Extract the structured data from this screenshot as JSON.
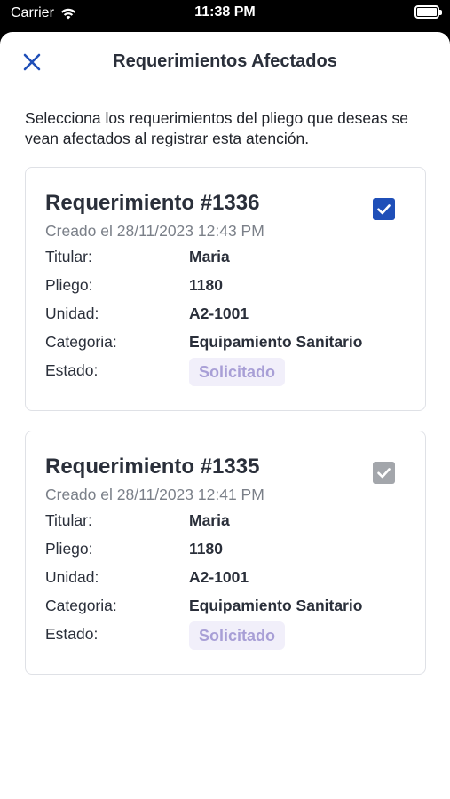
{
  "status_bar": {
    "carrier": "Carrier",
    "time": "11:38 PM"
  },
  "header": {
    "title": "Requerimientos Afectados",
    "close_icon": "close-icon"
  },
  "intro_text": "Selecciona los requerimientos del pliego que deseas se vean afectados al registrar esta atención.",
  "labels": {
    "titular": "Titular:",
    "pliego": "Pliego:",
    "unidad": "Unidad:",
    "categoria": "Categoria:",
    "estado": "Estado:"
  },
  "colors": {
    "accent": "#1f4fb8",
    "badge_bg": "#f1effa",
    "badge_text": "#a89fd6",
    "disabled_check": "#a3a6ab"
  },
  "cards": [
    {
      "title": "Requerimiento #1336",
      "date": "Creado el 28/11/2023 12:43 PM",
      "titular": "Maria",
      "pliego": "1180",
      "unidad": "A2-1001",
      "categoria": "Equipamiento Sanitario",
      "estado": "Solicitado",
      "checked": true,
      "enabled": true
    },
    {
      "title": "Requerimiento #1335",
      "date": "Creado el 28/11/2023 12:41 PM",
      "titular": "Maria",
      "pliego": "1180",
      "unidad": "A2-1001",
      "categoria": "Equipamiento Sanitario",
      "estado": "Solicitado",
      "checked": true,
      "enabled": false
    }
  ]
}
